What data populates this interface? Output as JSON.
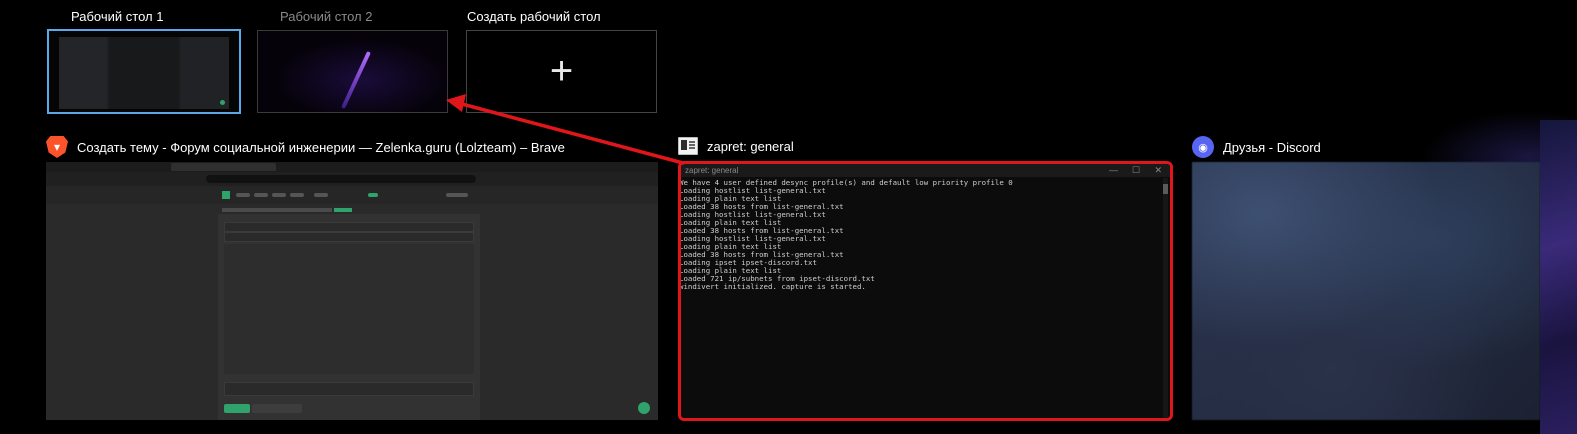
{
  "desktops": [
    {
      "label": "Рабочий стол 1",
      "active": true
    },
    {
      "label": "Рабочий стол 2",
      "active": false
    }
  ],
  "new_desktop": {
    "label": "Создать рабочий стол",
    "icon": "plus-icon",
    "glyph": "+"
  },
  "windows": {
    "brave": {
      "title": "Создать тему - Форум социальной инженерии — Zelenka.guru (Lolzteam) – Brave",
      "icon": "brave-lion-icon"
    },
    "terminal": {
      "title": "zapret: general",
      "icon": "terminal-window-icon",
      "titlebar_text": "zapret: general",
      "controls": [
        "—",
        "☐",
        "✕"
      ],
      "lines": [
        "We have 4 user defined desync profile(s) and default low priority profile 0",
        "Loading hostlist list-general.txt",
        "Loading plain text list",
        "Loaded 38 hosts from list-general.txt",
        "Loading hostlist list-general.txt",
        "Loading plain text list",
        "Loaded 38 hosts from list-general.txt",
        "Loading hostlist list-general.txt",
        "Loading plain text list",
        "Loaded 38 hosts from list-general.txt",
        "Loading ipset ipset-discord.txt",
        "Loading plain text list",
        "Loaded 721 ip/subnets from ipset-discord.txt",
        "windivert initialized. capture is started."
      ]
    },
    "discord": {
      "title": "Друзья - Discord",
      "icon": "discord-icon"
    }
  },
  "colors": {
    "highlight": "#e0161b",
    "active_desktop_border": "#5aa8e8",
    "accent_green": "#2fa36b"
  }
}
